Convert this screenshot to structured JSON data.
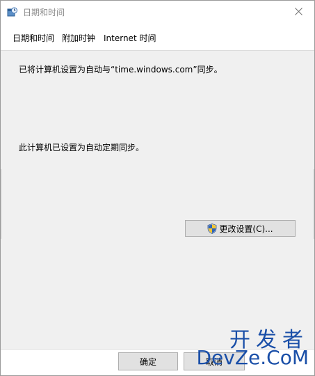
{
  "window": {
    "title": "日期和时间",
    "icon": "date-time-icon",
    "close_icon": "close-icon"
  },
  "tabs": [
    {
      "label": "日期和时间"
    },
    {
      "label": "附加时钟"
    },
    {
      "label": "Internet 时间"
    }
  ],
  "panel": {
    "sync_server_text": "已将计算机设置为自动与“time.windows.com”同步。",
    "auto_sync_text": "此计算机已设置为自动定期同步。",
    "change_settings_label": "更改设置(C)...",
    "change_settings_icon": "uac-shield-icon"
  },
  "footer": {
    "ok_label": "确定",
    "cancel_label": "取消"
  },
  "watermark": {
    "top": "开发者",
    "bottom": "DevZe.CoM"
  },
  "colors": {
    "panel_bg": "#f0f0f0",
    "button_bg": "#e1e1e1",
    "button_border": "#adadad",
    "watermark": "#1a4fa8"
  }
}
